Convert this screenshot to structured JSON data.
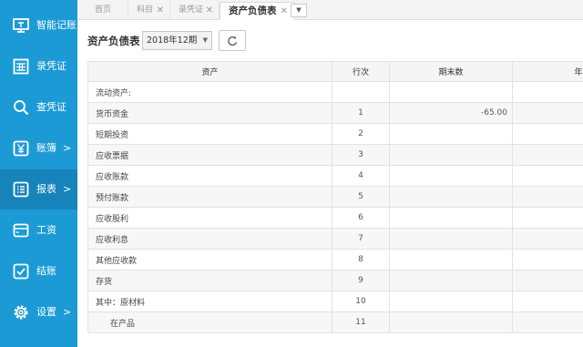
{
  "sidebar": {
    "items": [
      {
        "label": "智能记账",
        "icon": "monitor-icon",
        "arrow": ""
      },
      {
        "label": "录凭证",
        "icon": "calculator-icon",
        "arrow": ""
      },
      {
        "label": "查凭证",
        "icon": "search-icon",
        "arrow": ""
      },
      {
        "label": "账簿",
        "icon": "yen-icon",
        "arrow": ">"
      },
      {
        "label": "报表",
        "icon": "report-list-icon",
        "arrow": ">"
      },
      {
        "label": "工资",
        "icon": "wallet-icon",
        "arrow": ""
      },
      {
        "label": "结账",
        "icon": "checkbox-icon",
        "arrow": ""
      },
      {
        "label": "设置",
        "icon": "gear-icon",
        "arrow": ">"
      }
    ]
  },
  "tabs": [
    {
      "label": "首页",
      "close": ""
    },
    {
      "label": "科目",
      "close": "✕"
    },
    {
      "label": "录凭证",
      "close": "✕"
    },
    {
      "label": "资产负债表",
      "close": "✕"
    }
  ],
  "tab_dropdown": "▼",
  "page": {
    "title": "资产负债表",
    "period": "2018年12期",
    "period_caret": "▼"
  },
  "table": {
    "headers": [
      "资产",
      "行次",
      "期末数",
      "年初"
    ],
    "rows": [
      {
        "item": "流动资产:",
        "line": "",
        "end": "",
        "begin": ""
      },
      {
        "item": "货币资金",
        "line": "1",
        "end": "-65.00",
        "begin": ""
      },
      {
        "item": "短期投资",
        "line": "2",
        "end": "",
        "begin": ""
      },
      {
        "item": "应收票据",
        "line": "3",
        "end": "",
        "begin": ""
      },
      {
        "item": "应收账款",
        "line": "4",
        "end": "",
        "begin": ""
      },
      {
        "item": "预付账款",
        "line": "5",
        "end": "",
        "begin": ""
      },
      {
        "item": "应收股利",
        "line": "6",
        "end": "",
        "begin": ""
      },
      {
        "item": "应收利息",
        "line": "7",
        "end": "",
        "begin": ""
      },
      {
        "item": "其他应收款",
        "line": "8",
        "end": "",
        "begin": ""
      },
      {
        "item": "存货",
        "line": "9",
        "end": "",
        "begin": ""
      },
      {
        "item": "其中：原材料",
        "line": "10",
        "end": "",
        "begin": ""
      },
      {
        "item": "在产品",
        "line": "11",
        "end": "",
        "begin": ""
      }
    ]
  },
  "colors": {
    "sidebar": "#1c9ad6",
    "sidebar_active": "#1683ba"
  }
}
